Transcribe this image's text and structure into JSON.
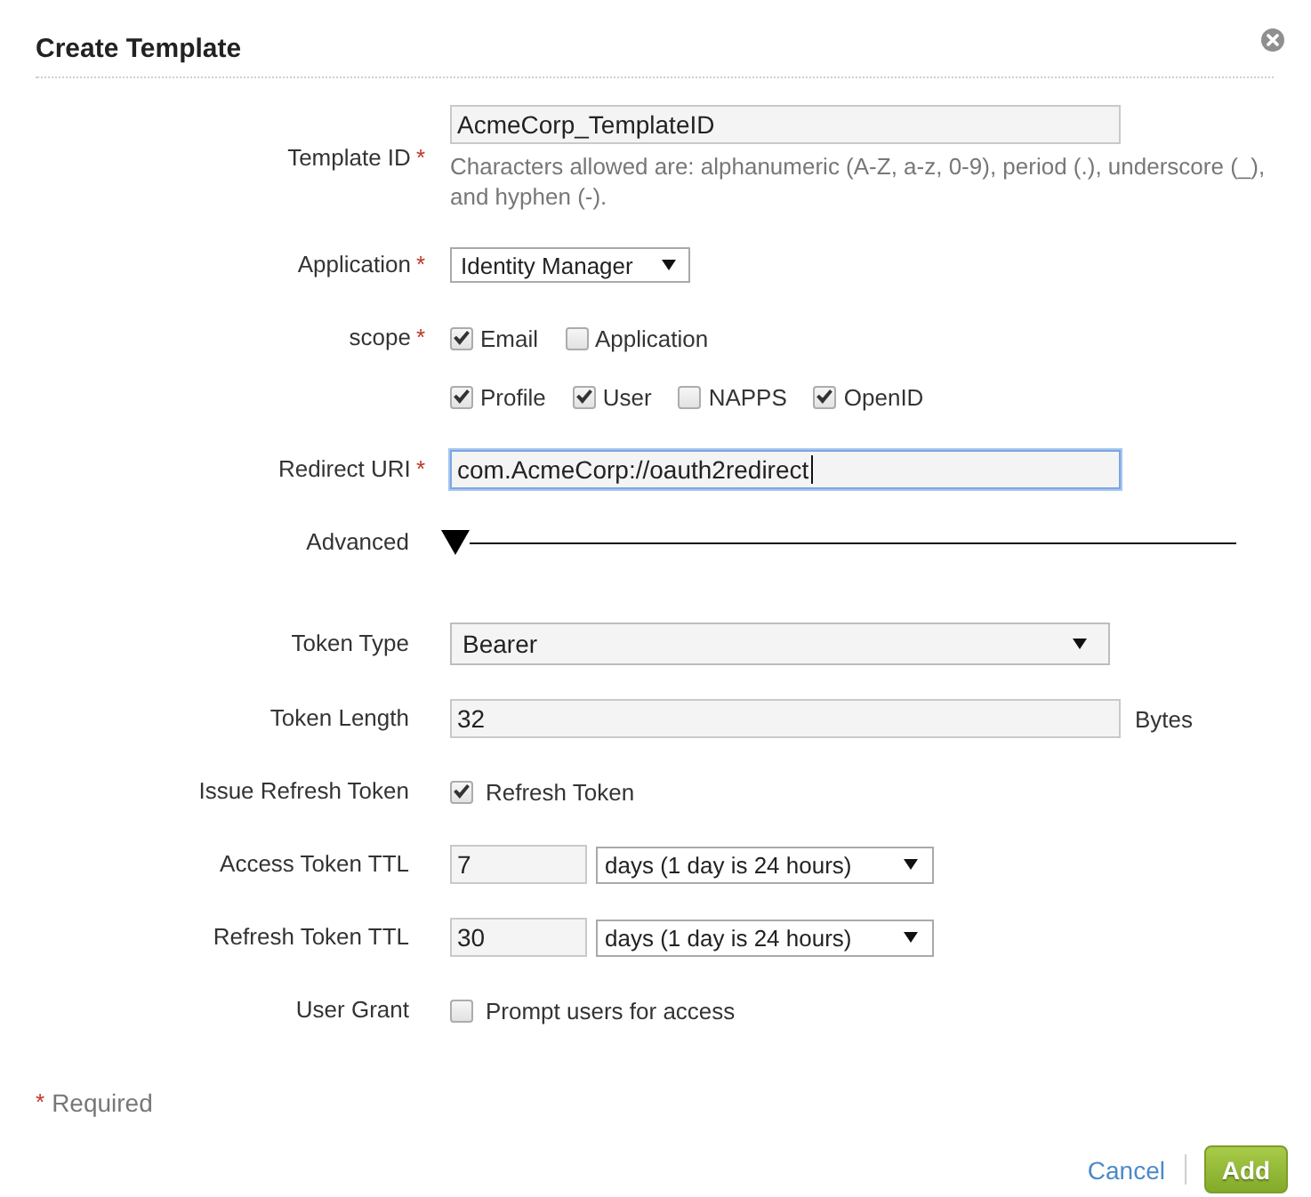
{
  "dialog": {
    "title": "Create Template"
  },
  "form": {
    "fields": [
      {
        "kind": "text",
        "label": "Template ID",
        "required_mark": "*",
        "value": "AcmeCorp_TemplateID",
        "focused": false,
        "hint": "Characters allowed are: alphanumeric (A-Z, a-z, 0-9), period (.), underscore (_), and hyphen (-)."
      },
      {
        "kind": "select",
        "label": "Application",
        "required_mark": "*",
        "value": "Identity Manager"
      },
      {
        "kind": "checkboxes",
        "label": "scope",
        "required_mark": "*",
        "rows": [
          {
            "options": [
              {
                "label": "Email",
                "checked": true
              },
              {
                "label": "Application",
                "checked": false
              }
            ]
          },
          {
            "options": [
              {
                "label": "Profile",
                "checked": true
              },
              {
                "label": "User",
                "checked": true
              },
              {
                "label": "NAPPS",
                "checked": false
              },
              {
                "label": "OpenID",
                "checked": true
              }
            ]
          }
        ]
      },
      {
        "kind": "text",
        "label": "Redirect URI",
        "required_mark": "*",
        "value": "com.AcmeCorp://oauth2redirect",
        "focused": true
      }
    ]
  },
  "advanced": {
    "label": "Advanced",
    "expanded": true,
    "fields": [
      {
        "kind": "wide_select",
        "label": "Token Type",
        "value": "Bearer"
      },
      {
        "kind": "text",
        "label": "Token Length",
        "value": "32",
        "suffix": "Bytes",
        "focused": false
      },
      {
        "kind": "checkbox",
        "label": "Issue Refresh Token",
        "option": "Refresh Token",
        "checked": true
      },
      {
        "kind": "duration",
        "label": "Access Token TTL",
        "value": "7",
        "unit": "days (1 day is 24 hours)"
      },
      {
        "kind": "duration",
        "label": "Refresh Token TTL",
        "value": "30",
        "unit": "days (1 day is 24 hours)"
      },
      {
        "kind": "checkbox",
        "label": "User Grant",
        "option": "Prompt users for access",
        "checked": false
      }
    ]
  },
  "footer": {
    "required_note": {
      "mark": "*",
      "text": "Required"
    },
    "buttons": [
      {
        "kind": "link",
        "label": "Cancel"
      },
      {
        "kind": "primary",
        "label": "Add"
      }
    ]
  }
}
